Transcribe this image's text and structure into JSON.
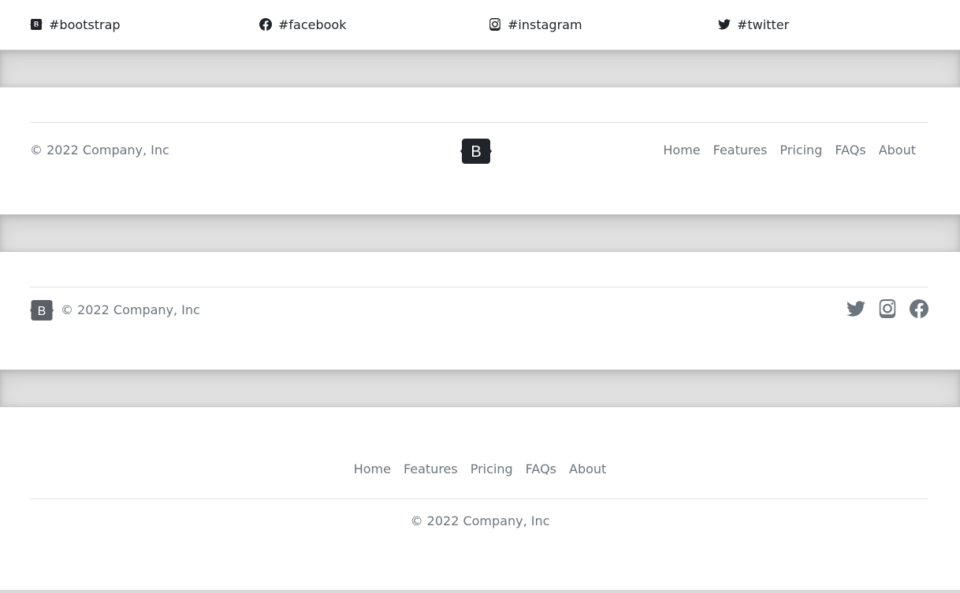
{
  "icon_row": {
    "items": [
      {
        "label": "#bootstrap",
        "icon": "bootstrap-icon"
      },
      {
        "label": "#facebook",
        "icon": "facebook-icon"
      },
      {
        "label": "#instagram",
        "icon": "instagram-icon"
      },
      {
        "label": "#twitter",
        "icon": "twitter-icon"
      }
    ]
  },
  "footer1": {
    "copyright": "© 2022 Company, Inc",
    "logo_letter": "B",
    "nav": [
      "Home",
      "Features",
      "Pricing",
      "FAQs",
      "About"
    ]
  },
  "footer2": {
    "copyright": "© 2022 Company, Inc",
    "logo_letter": "B",
    "social": [
      "twitter-icon",
      "instagram-icon",
      "facebook-icon"
    ]
  },
  "footer3": {
    "nav": [
      "Home",
      "Features",
      "Pricing",
      "FAQs",
      "About"
    ],
    "copyright": "© 2022 Company, Inc"
  },
  "colors": {
    "text": "#212529",
    "muted": "#6c757d",
    "band": "#e1e1e1",
    "border": "#dee2e6",
    "logo_bg": "#212529"
  }
}
